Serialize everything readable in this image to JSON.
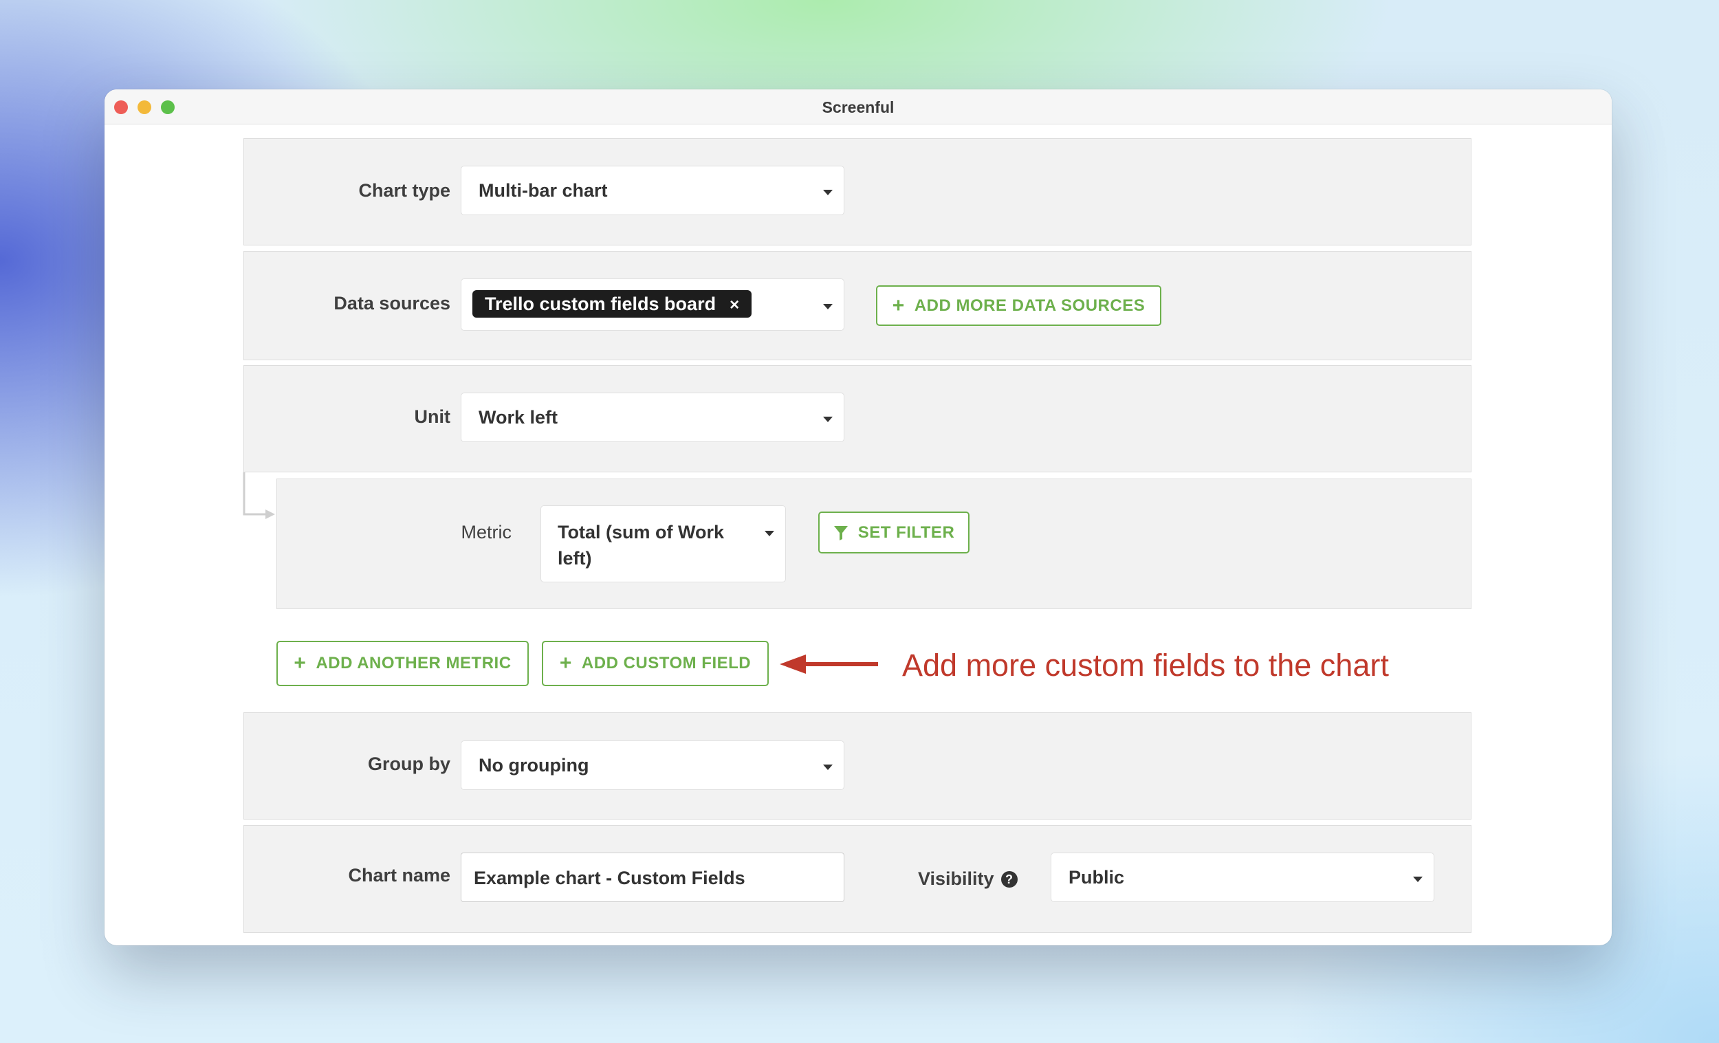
{
  "window": {
    "title": "Screenful"
  },
  "chart_type": {
    "label": "Chart type",
    "value": "Multi-bar chart"
  },
  "data_sources": {
    "label": "Data sources",
    "tag": "Trello custom fields board",
    "tag_remove": "×",
    "add_button": "ADD MORE DATA SOURCES"
  },
  "unit": {
    "label": "Unit",
    "value": "Work left"
  },
  "metric": {
    "label": "Metric",
    "value_line1": "Total (sum of Work",
    "value_line2": "left)",
    "filter_button": "SET FILTER"
  },
  "actions": {
    "add_metric": "ADD ANOTHER METRIC",
    "add_custom_field": "ADD CUSTOM FIELD",
    "plus": "+"
  },
  "annotation": {
    "text": "Add more custom fields to the chart",
    "color": "#c0392b"
  },
  "group_by": {
    "label": "Group by",
    "value": "No grouping"
  },
  "chart_name": {
    "label": "Chart name",
    "value": "Example chart - Custom Fields"
  },
  "visibility": {
    "label": "Visibility",
    "help": "?",
    "value": "Public"
  },
  "colors": {
    "accent": "#6db04c",
    "annotation": "#c0392b"
  }
}
